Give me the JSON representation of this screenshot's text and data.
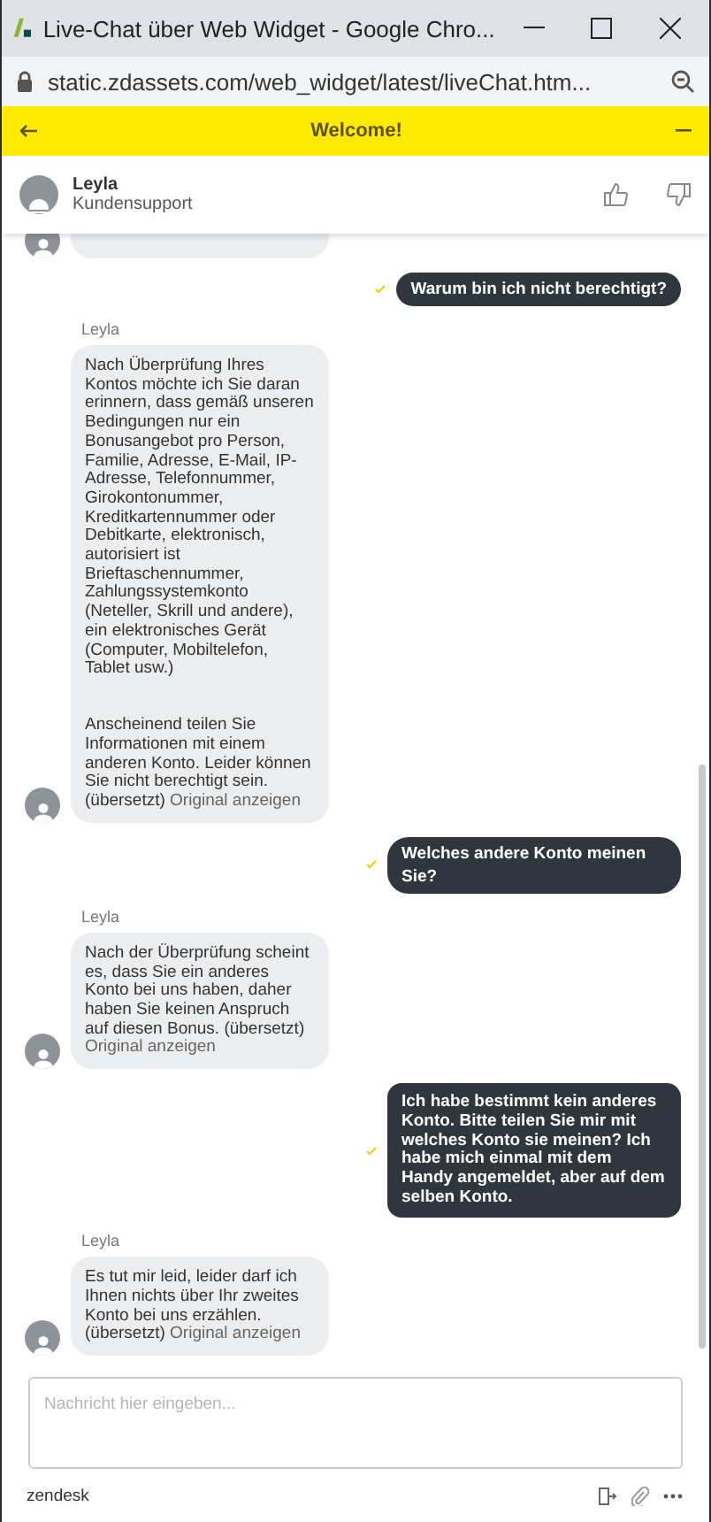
{
  "window": {
    "title": "Live-Chat über Web Widget - Google Chro..."
  },
  "address_bar": {
    "url": "static.zdassets.com/web_widget/latest/liveChat.htm..."
  },
  "widget_header": {
    "title": "Welcome!"
  },
  "agent": {
    "name": "Leyla",
    "role": "Kundensupport"
  },
  "messages": [
    {
      "kind": "stub"
    },
    {
      "kind": "visitor",
      "text": "Warum bin ich nicht berechtigt?"
    },
    {
      "kind": "agent",
      "sender": "Leyla",
      "text": "Nach Überprüfung Ihres Kontos möchte ich Sie daran erinnern, dass gemäß unseren Bedingungen nur ein Bonusangebot pro Person, Familie, Adresse, E-Mail, IP-Adresse, Telefonnummer, Girokontonummer, Kreditkartennummer oder Debitkarte, elektronisch, autorisiert ist Brieftaschennummer, Zahlungssystemkonto (Neteller, Skrill und andere), ein elektronisches Gerät (Computer, Mobiltelefon, Tablet usw.)\n\n\nAnscheinend teilen Sie Informationen mit einem anderen Konto. Leider können Sie nicht berechtigt sein.",
      "note": "(übersetzt)",
      "link": "Original anzeigen"
    },
    {
      "kind": "visitor",
      "text": "Welches andere Konto meinen Sie?"
    },
    {
      "kind": "agent",
      "sender": "Leyla",
      "text": "Nach der Überprüfung scheint es, dass Sie ein anderes Konto bei uns haben, daher haben Sie keinen Anspruch auf diesen Bonus.",
      "note": "(übersetzt)",
      "link": "Original anzeigen"
    },
    {
      "kind": "visitor",
      "text": "Ich habe bestimmt kein anderes Konto. Bitte teilen Sie mir mit welches Konto sie meinen? Ich habe mich einmal mit dem Handy angemeldet, aber auf dem selben Konto."
    },
    {
      "kind": "agent",
      "sender": "Leyla",
      "text": "Es tut mir leid, leider darf ich Ihnen nichts über Ihr zweites Konto bei uns erzählen.",
      "note": "(übersetzt)",
      "link": "Original anzeigen"
    }
  ],
  "composer": {
    "placeholder": "Nachricht hier eingeben..."
  },
  "footer": {
    "brand": "zendesk"
  }
}
